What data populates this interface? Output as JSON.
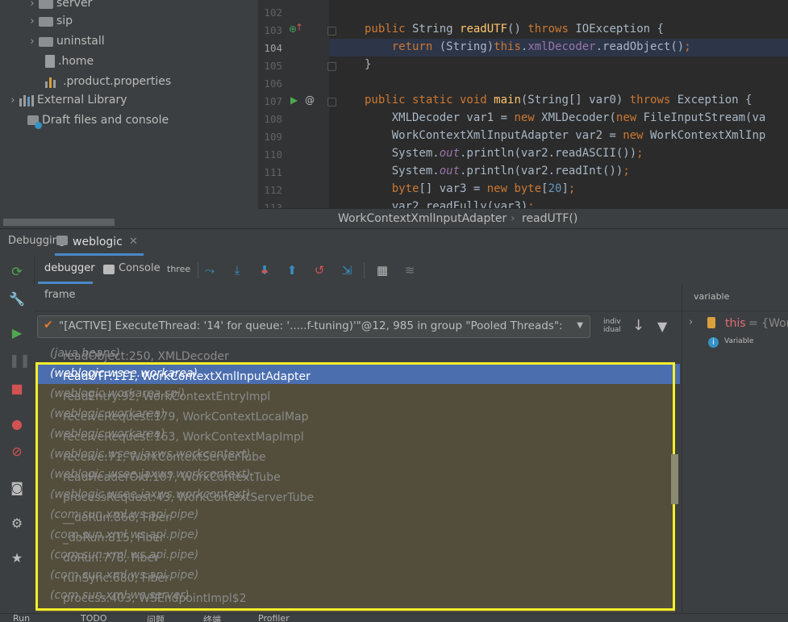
{
  "project_tree": {
    "items": [
      {
        "label": "server",
        "type": "folder",
        "expandable": true
      },
      {
        "label": "sip",
        "type": "folder",
        "expandable": true
      },
      {
        "label": "uninstall",
        "type": "folder",
        "expandable": true
      },
      {
        "label": ".home",
        "type": "file",
        "expandable": false
      },
      {
        "label": ".product.properties",
        "type": "file",
        "expandable": false
      },
      {
        "label": "External Library",
        "type": "library",
        "expandable": true
      },
      {
        "label": "Draft files and console",
        "type": "scratch",
        "expandable": false
      }
    ]
  },
  "editor": {
    "lines": [
      {
        "num": "102"
      },
      {
        "num": "103"
      },
      {
        "num": "104"
      },
      {
        "num": "105"
      },
      {
        "num": "106"
      },
      {
        "num": "107"
      },
      {
        "num": "108"
      },
      {
        "num": "109"
      },
      {
        "num": "110"
      },
      {
        "num": "111"
      },
      {
        "num": "112"
      },
      {
        "num": "113"
      }
    ],
    "current_line": "104"
  },
  "breadcrumb": {
    "class_name": "WorkContextXmlInputAdapter",
    "method": "readUTF()"
  },
  "debug": {
    "tool_title": "Debugging:",
    "session_tab": "weblogic",
    "tabs": {
      "debugger": "debugger",
      "console": "Console",
      "threads": "three"
    },
    "frame_header": "frame",
    "variables_header": "variable",
    "thread_selector": "\"[ACTIVE] ExecuteThread: '14' for queue: '.....f-tuning)'\"@12, 985 in group \"Pooled Threads\": Running",
    "individual_label": "indiv idual",
    "frames": [
      {
        "method": "readObject:250, XMLDecoder",
        "pkg": "(java.beans)"
      },
      {
        "method": "readUTF:111, WorkContextXmlInputAdapter",
        "pkg": "(weblogic.wsee.workarea)"
      },
      {
        "method": "readEntry:92, WorkContextEntryImpl",
        "pkg": "(weblogic.workarea.spi)"
      },
      {
        "method": "receiveRequest:179, WorkContextLocalMap",
        "pkg": "(weblogic.workarea)"
      },
      {
        "method": "receiveRequest:163, WorkContextMapImpl",
        "pkg": "(weblogic.workarea)"
      },
      {
        "method": "receive:71, WorkContextServerTube",
        "pkg": "(weblogic.wsee.jaxws.workcontext)"
      },
      {
        "method": "readHeaderOld:107, WorkContextTube",
        "pkg": "(weblogic.wsee.jaxws.workcontext)"
      },
      {
        "method": "processRequest:43, WorkContextServerTube",
        "pkg": "(weblogic.wsee.jaxws.workcontext)"
      },
      {
        "method": "__doRun:866, Fiber",
        "pkg": "(com.sun.xml.ws.api.pipe)"
      },
      {
        "method": "_doRun:815, Fiber",
        "pkg": "(com.sun.xml.ws.api.pipe)"
      },
      {
        "method": "doRun:778, Fiber",
        "pkg": "(com.sun.xml.ws.api.pipe)"
      },
      {
        "method": "runSync:680, Fiber",
        "pkg": "(com.sun.xml.ws.api.pipe)"
      },
      {
        "method": "process:403, WSEndpointImpl$2",
        "pkg": "(com.sun.xml.ws.server)"
      }
    ],
    "selected_frame_index": 1,
    "variables": {
      "this_name": "this",
      "this_value": "= {Work",
      "info_text": "Variable"
    }
  },
  "bottom_bar": {
    "items": [
      "Run",
      "TODO",
      "问题",
      "终端",
      "Profiler"
    ]
  },
  "colors": {
    "accent_selection": "#4b6eaf",
    "highlight_box": "#f5ee2a",
    "keyword": "#cc7832",
    "method": "#ffc66d"
  }
}
